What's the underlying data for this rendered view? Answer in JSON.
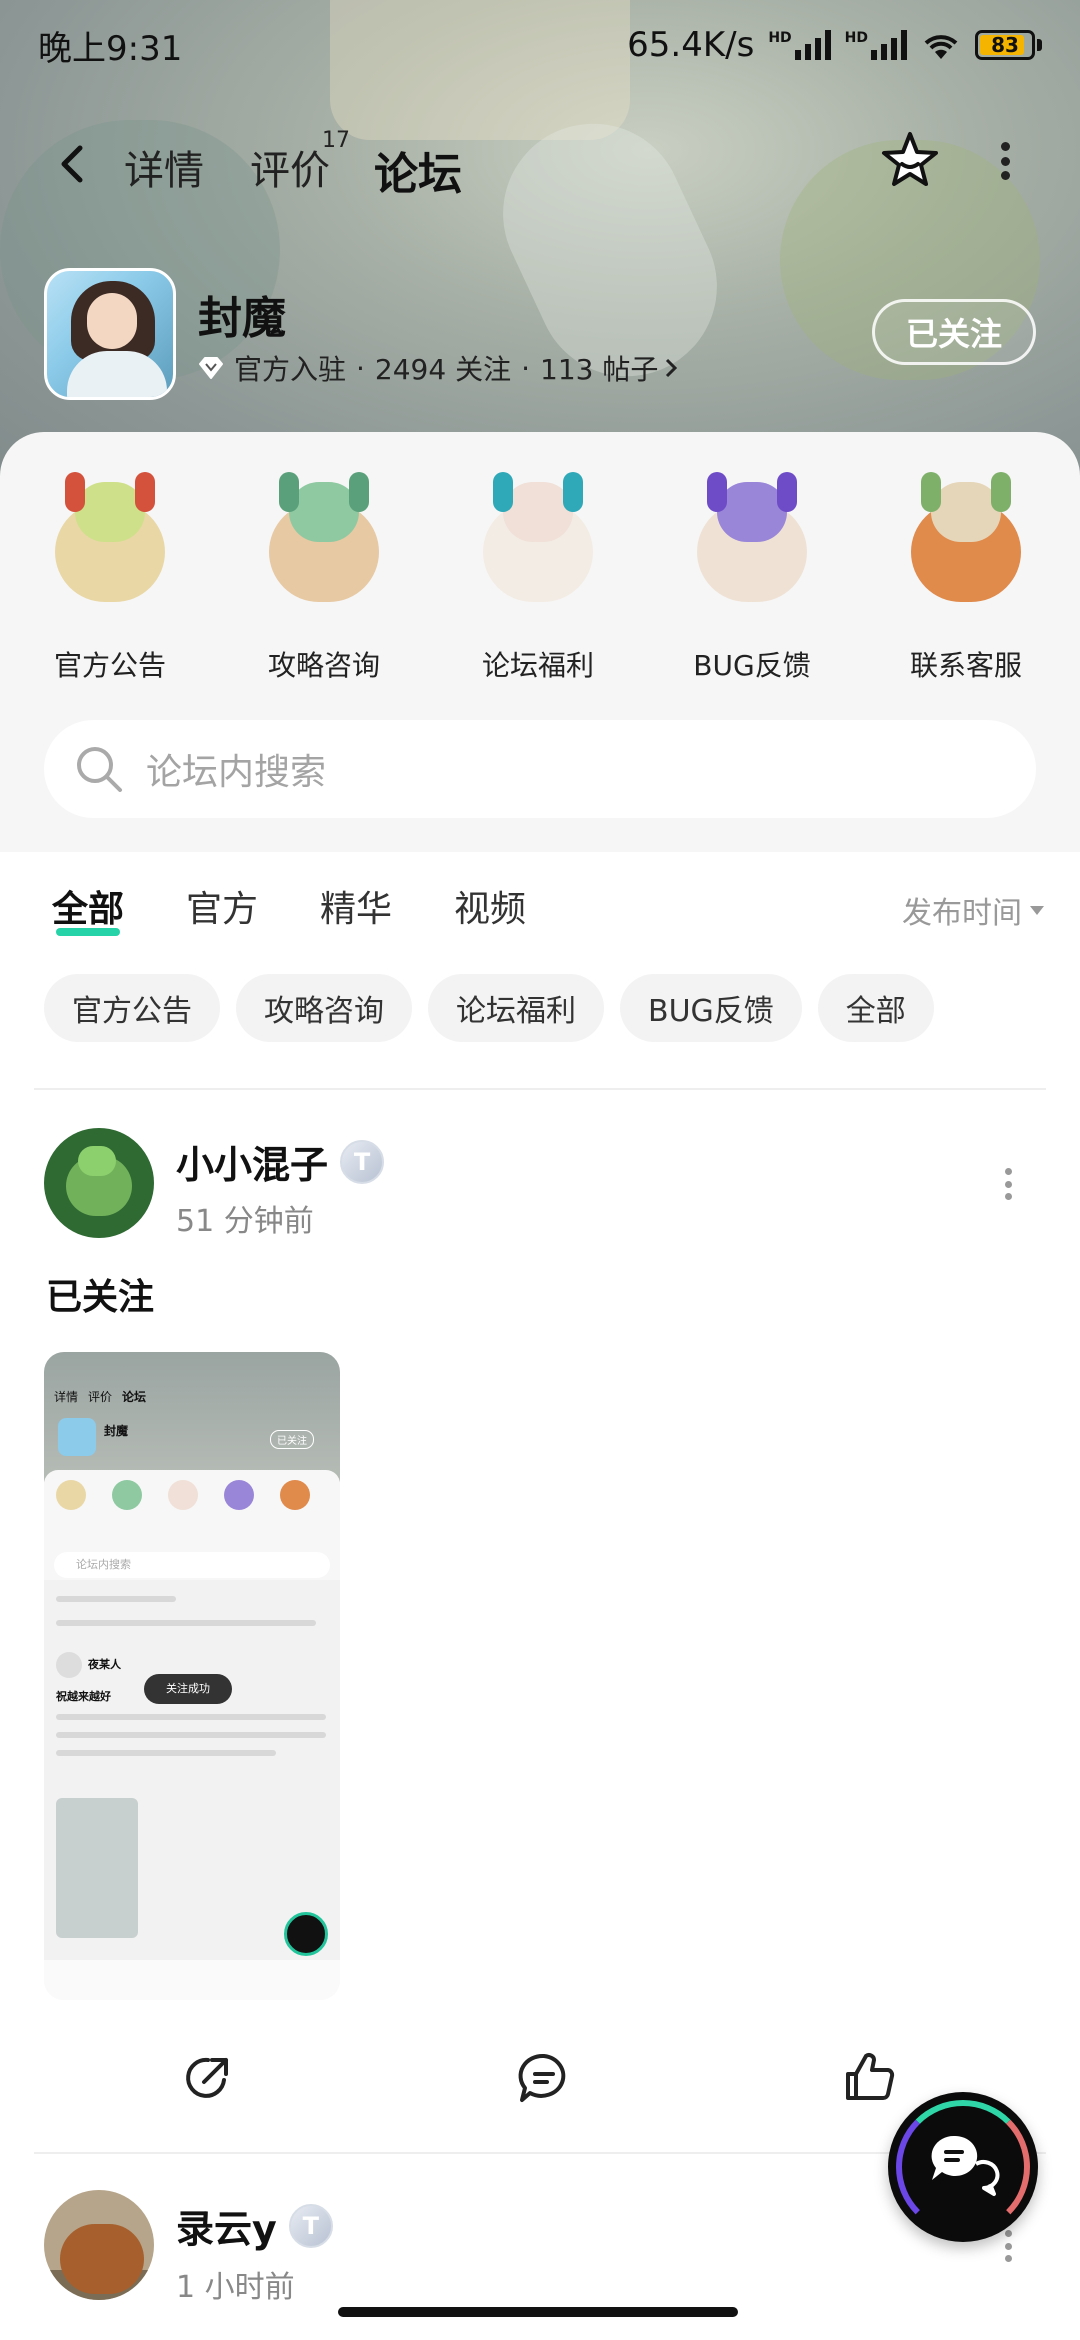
{
  "status_bar": {
    "time": "晚上9:31",
    "net_speed": "65.4K/s",
    "hd1": "HD",
    "hd2": "HD",
    "battery": "83"
  },
  "nav": {
    "tabs": [
      {
        "label": "详情"
      },
      {
        "label": "评价",
        "count": "17"
      },
      {
        "label": "论坛"
      }
    ],
    "active_tab": "论坛",
    "accent": "#26d3a8"
  },
  "game": {
    "name": "封魔",
    "official": "官方入驻",
    "followers": "2494 关注",
    "posts": "113 帖子",
    "separator": "·",
    "follow_button": "已关注"
  },
  "categories": [
    {
      "label": "官方公告"
    },
    {
      "label": "攻略咨询"
    },
    {
      "label": "论坛福利"
    },
    {
      "label": "BUG反馈"
    },
    {
      "label": "联系客服"
    }
  ],
  "search": {
    "placeholder": "论坛内搜索"
  },
  "filter_tabs": [
    {
      "label": "全部"
    },
    {
      "label": "官方"
    },
    {
      "label": "精华"
    },
    {
      "label": "视频"
    }
  ],
  "sort_label": "发布时间",
  "chips": [
    {
      "label": "官方公告"
    },
    {
      "label": "攻略咨询"
    },
    {
      "label": "论坛福利"
    },
    {
      "label": "BUG反馈"
    },
    {
      "label": "全部"
    }
  ],
  "posts": [
    {
      "author": "小小混子",
      "badge": "T",
      "time": "51 分钟前",
      "title": "已关注"
    },
    {
      "author": "录云y",
      "badge": "T",
      "time": "1 小时前"
    }
  ],
  "thumbnail": {
    "tabs": [
      "详情",
      "评价",
      "论坛"
    ],
    "game_name": "封魔",
    "follow": "已关注",
    "search_placeholder": "论坛内搜索",
    "toast": "关注成功",
    "post_author": "夜某人",
    "post_title": "祝越来越好"
  }
}
